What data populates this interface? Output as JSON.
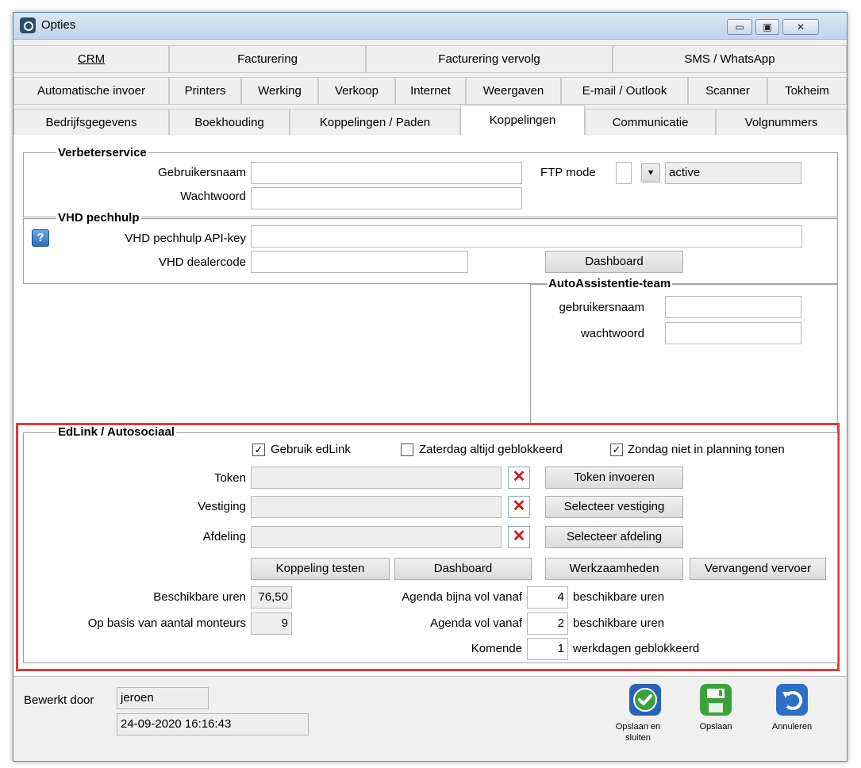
{
  "window": {
    "title": "Opties",
    "controls": {
      "minimize": "▭",
      "maximize": "▣",
      "close": "✕"
    }
  },
  "tabs": {
    "row1": [
      "CRM",
      "Facturering",
      "Facturering vervolg",
      "SMS / WhatsApp"
    ],
    "row2": [
      "Automatische invoer",
      "Printers",
      "Werking",
      "Verkoop",
      "Internet",
      "Weergaven",
      "E-mail / Outlook",
      "Scanner",
      "Tokheim"
    ],
    "row3": [
      "Bedrijfsgegevens",
      "Boekhouding",
      "Koppelingen / Paden",
      "Koppelingen",
      "Communicatie",
      "Volgnummers"
    ],
    "active": "Koppelingen"
  },
  "verbeterservice": {
    "legend": "Verbeterservice",
    "gebruikersnaam_label": "Gebruikersnaam",
    "gebruikersnaam_value": "",
    "wachtwoord_label": "Wachtwoord",
    "wachtwoord_value": "",
    "ftp_mode_label": "FTP mode",
    "ftp_mode_value": "active",
    "ftp_dropdown_icon": "⯆"
  },
  "vhd": {
    "legend": "VHD pechhulp",
    "help_icon": "?",
    "api_key_label": "VHD pechhulp API-key",
    "api_key_value": "",
    "dealercode_label": "VHD dealercode",
    "dealercode_value": "",
    "dashboard_button": "Dashboard"
  },
  "autoassistentie": {
    "legend": "AutoAssistentie-team",
    "gebruikersnaam_label": "gebruikersnaam",
    "gebruikersnaam_value": "",
    "wachtwoord_label": "wachtwoord",
    "wachtwoord_value": ""
  },
  "edlink": {
    "legend": "EdLink / Autosociaal",
    "gebruik_edlink": {
      "label": "Gebruik edLink",
      "checked": "✓"
    },
    "zaterdag": {
      "label": "Zaterdag altijd geblokkeerd",
      "checked": ""
    },
    "zondag": {
      "label": "Zondag niet in planning tonen",
      "checked": "✓"
    },
    "token_label": "Token",
    "token_value": "",
    "vestiging_label": "Vestiging",
    "vestiging_value": "",
    "afdeling_label": "Afdeling",
    "afdeling_value": "",
    "clear_icon": "✕",
    "token_button": "Token invoeren",
    "vestiging_button": "Selecteer vestiging",
    "afdeling_button": "Selecteer afdeling",
    "koppeling_testen_button": "Koppeling testen",
    "dashboard_button": "Dashboard",
    "werkzaamheden_button": "Werkzaamheden",
    "vervangend_vervoer_button": "Vervangend vervoer",
    "beschikbare_uren_label": "Beschikbare uren",
    "beschikbare_uren_value": "76,50",
    "aantal_monteurs_label": "Op basis van aantal monteurs",
    "aantal_monteurs_value": "9",
    "agenda_bijna_vol_label": "Agenda bijna vol vanaf",
    "agenda_bijna_vol_value": "4",
    "agenda_vol_label": "Agenda vol vanaf",
    "agenda_vol_value": "2",
    "beschikbare_uren_suffix": "beschikbare uren",
    "komende_label": "Komende",
    "komende_value": "1",
    "werkdagen_suffix": "werkdagen geblokkeerd"
  },
  "footer": {
    "bewerkt_door_label": "Bewerkt door",
    "bewerkt_door_value": "jeroen",
    "timestamp": "24-09-2020 16:16:43",
    "opslaan_en_sluiten": "Opslaan en sluiten",
    "opslaan": "Opslaan",
    "annuleren": "Annuleren"
  },
  "colors": {
    "highlight": "#e5383b",
    "clear_x": "#d01818",
    "save_green": "#3aa23a",
    "cancel_blue": "#2d6fc6"
  }
}
